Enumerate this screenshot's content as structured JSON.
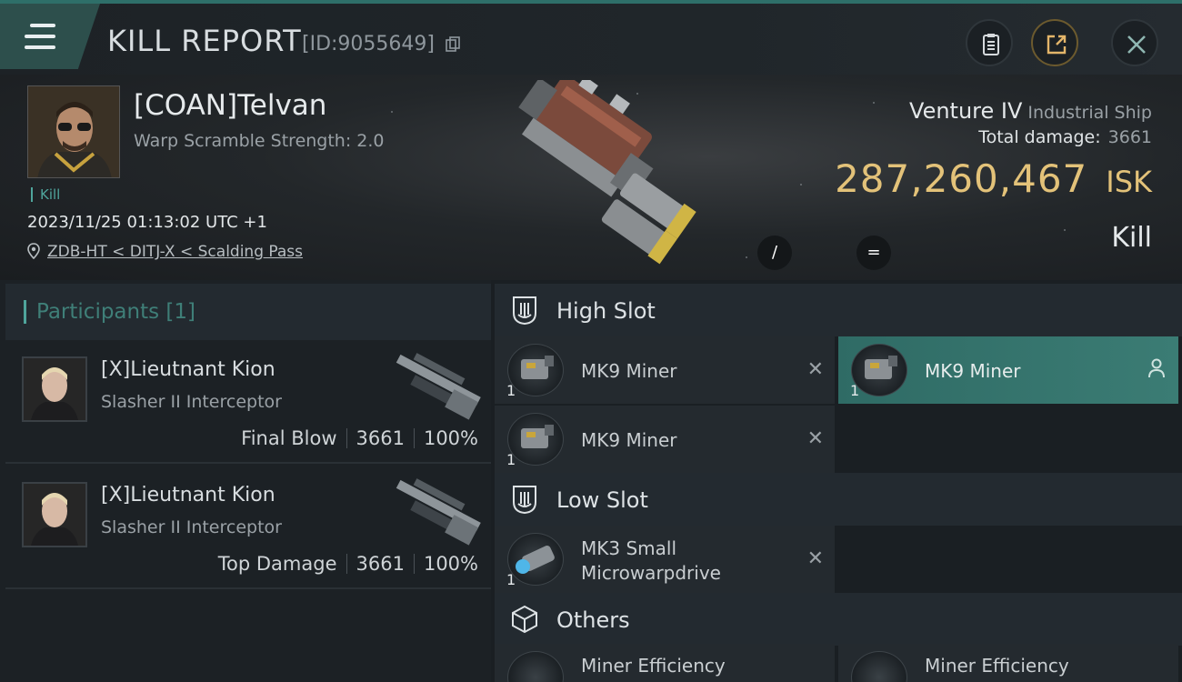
{
  "header": {
    "title": "KILL REPORT",
    "report_id": "[ID:9055649]"
  },
  "victim": {
    "name": "[COAN]Telvan",
    "warp_scramble": "Warp Scramble Strength: 2.0",
    "tag": "Kill",
    "timestamp": "2023/11/25 01:13:02 UTC +1",
    "location": "ZDB-HT < DITJ-X < Scalding Pass",
    "ship_name": "Venture IV",
    "ship_class": "Industrial Ship",
    "total_damage_label": "Total damage:",
    "total_damage": "3661",
    "isk_value": "287,260,467",
    "isk_unit": "ISK",
    "result": "Kill"
  },
  "hero_buttons": {
    "left_symbol": "/",
    "right_symbol": "="
  },
  "participants": {
    "label": "Participants",
    "count": "[1]",
    "rows": [
      {
        "name": "[X]Lieutnant Kion",
        "ship": "Slasher II Interceptor",
        "role": "Final Blow",
        "damage": "3661",
        "percent": "100%"
      },
      {
        "name": "[X]Lieutnant Kion",
        "ship": "Slasher II Interceptor",
        "role": "Top Damage",
        "damage": "3661",
        "percent": "100%"
      }
    ]
  },
  "fitting": {
    "high_slot_label": "High Slot",
    "low_slot_label": "Low Slot",
    "others_label": "Others",
    "high": [
      {
        "name": "MK9 Miner",
        "qty": "1"
      },
      {
        "name": "MK9 Miner",
        "qty": "1"
      },
      {
        "name": "MK9 Miner",
        "qty": "1"
      }
    ],
    "low": [
      {
        "name_line1": "MK3 Small",
        "name_line2": "Microwarpdrive",
        "qty": "1"
      }
    ],
    "others": [
      {
        "name": "Miner Efficiency"
      },
      {
        "name": "Miner Efficiency"
      }
    ]
  },
  "colors": {
    "accent_teal": "#4fa59c",
    "isk_gold": "#e3c279",
    "active_module": "#3b7c74"
  }
}
